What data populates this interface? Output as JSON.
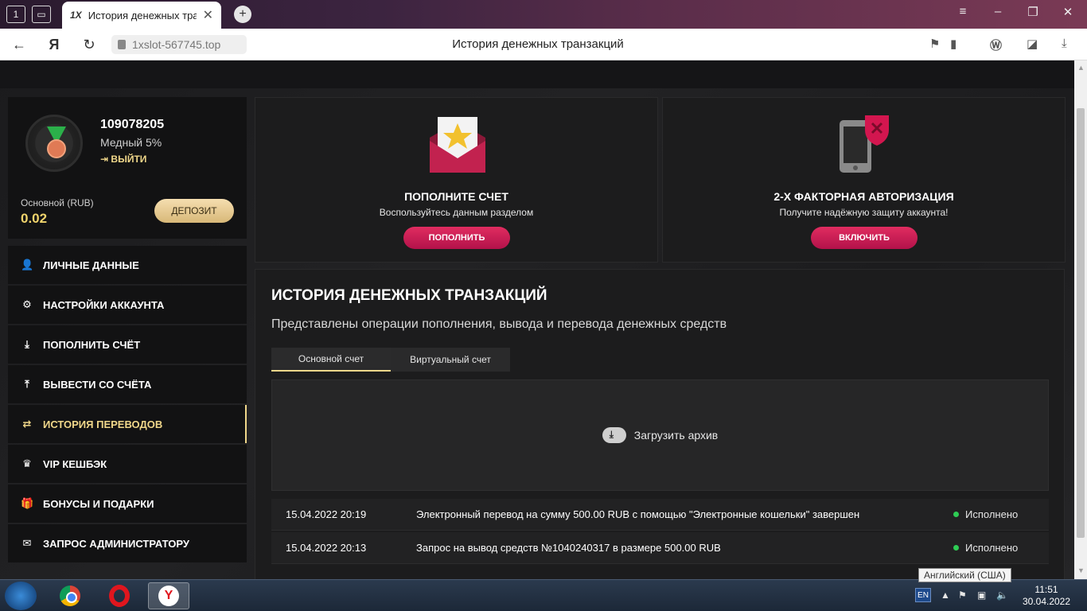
{
  "browser": {
    "tab_title": "История денежных тра",
    "tab_favicon": "1X",
    "url": "1xslot-567745.top",
    "page_title": "История денежных транзакций"
  },
  "profile": {
    "user_id": "109078205",
    "rank": "Медный 5%",
    "logout": "ВЫЙТИ",
    "balance_label": "Основной (RUB)",
    "balance_value": "0.02",
    "deposit_button": "ДЕПОЗИТ"
  },
  "menu": {
    "items": [
      {
        "label": "ЛИЧНЫЕ ДАННЫЕ",
        "icon": "user-plus-icon"
      },
      {
        "label": "НАСТРОЙКИ АККАУНТА",
        "icon": "gears-icon"
      },
      {
        "label": "ПОПОЛНИТЬ СЧЁТ",
        "icon": "download-icon"
      },
      {
        "label": "ВЫВЕСТИ СО СЧЁТА",
        "icon": "upload-icon"
      },
      {
        "label": "ИСТОРИЯ ПЕРЕВОДОВ",
        "icon": "transfer-icon"
      },
      {
        "label": "VIP КЕШБЭК",
        "icon": "crown-icon"
      },
      {
        "label": "БОНУСЫ И ПОДАРКИ",
        "icon": "gift-icon"
      },
      {
        "label": "ЗАПРОС АДМИНИСТРАТОРУ",
        "icon": "envelope-icon"
      }
    ],
    "active_index": 4
  },
  "cards": {
    "deposit": {
      "title": "ПОПОЛНИТЕ СЧЕТ",
      "subtitle": "Воспользуйтесь данным разделом",
      "button": "ПОПОЛНИТЬ"
    },
    "twofa": {
      "title": "2-Х ФАКТОРНАЯ АВТОРИЗАЦИЯ",
      "subtitle": "Получите надёжную защиту аккаунта!",
      "button": "ВКЛЮЧИТЬ"
    }
  },
  "history": {
    "title": "ИСТОРИЯ ДЕНЕЖНЫХ ТРАНЗАКЦИЙ",
    "subtitle": "Представлены операции пополнения, вывода и перевода денежных средств",
    "tabs": [
      "Основной счет",
      "Виртуальный счет"
    ],
    "archive_label": "Загрузить архив",
    "transactions": [
      {
        "date": "15.04.2022 20:19",
        "description": "Электронный перевод на сумму 500.00 RUB с помощью \"Электронные кошельки\" завершен",
        "status": "Исполнено"
      },
      {
        "date": "15.04.2022 20:13",
        "description": "Запрос на вывод средств №1040240317 в размере 500.00 RUB",
        "status": "Исполнено"
      }
    ]
  },
  "taskbar": {
    "language": "EN",
    "tooltip": "Английский (США)",
    "time": "11:51",
    "date": "30.04.2022"
  },
  "colors": {
    "accent_gold": "#f0d78a",
    "button_pink": "#c81a52",
    "status_green": "#2ecc54"
  }
}
